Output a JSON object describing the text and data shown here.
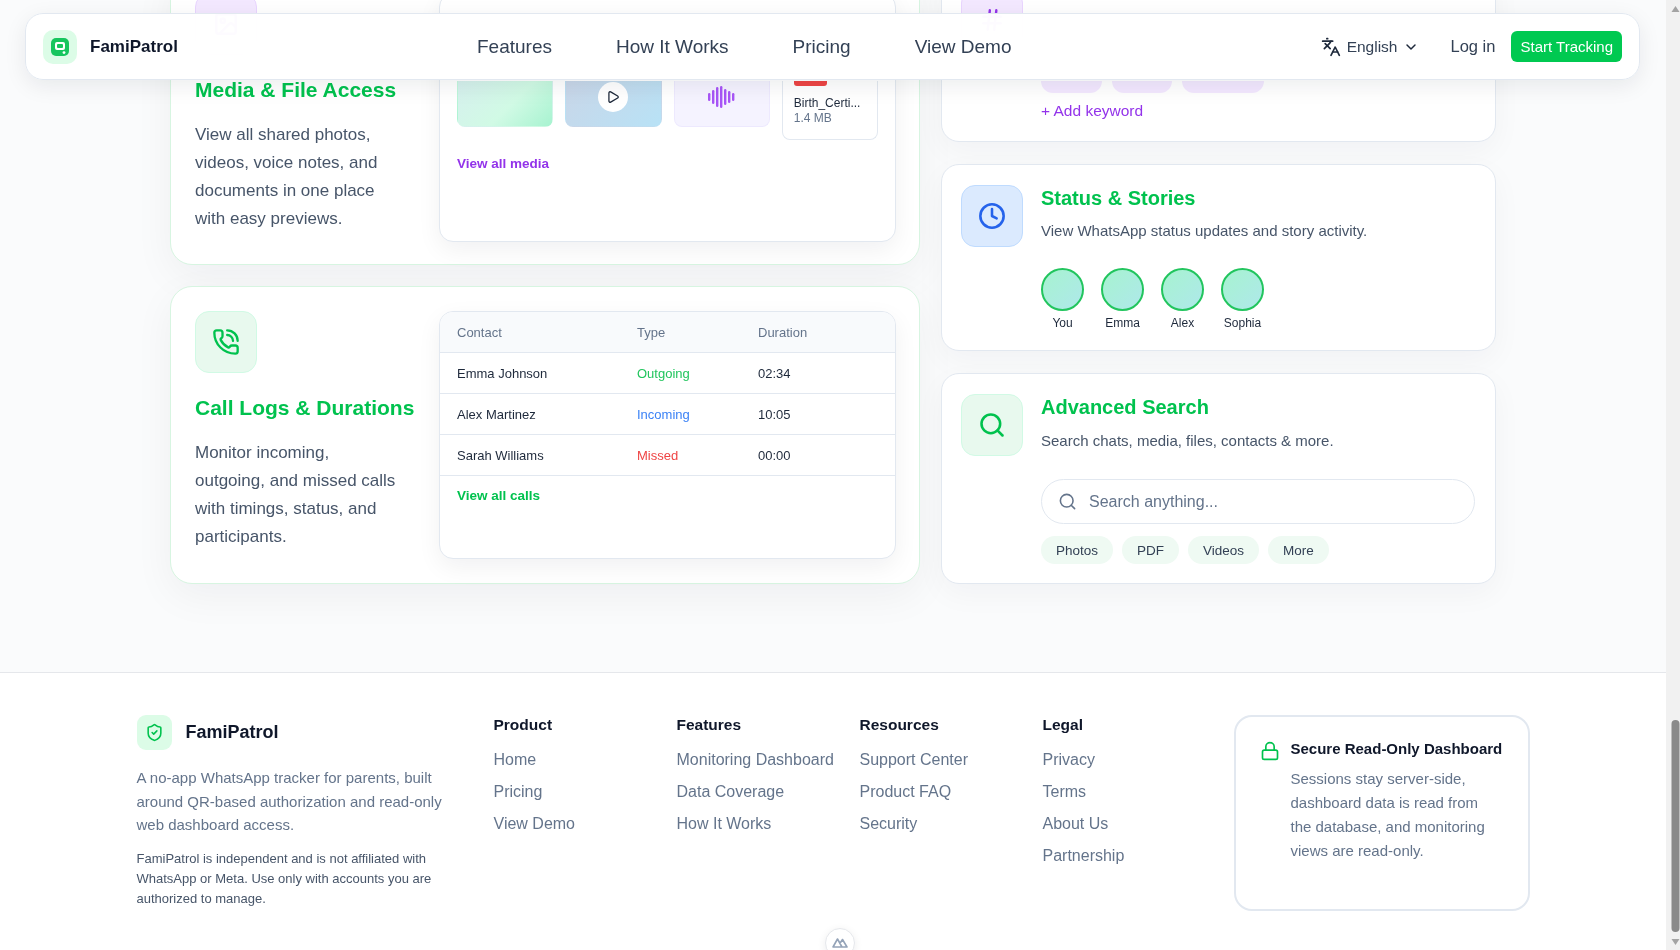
{
  "navbar": {
    "brand": "FamiPatrol",
    "links": [
      "Features",
      "How It Works",
      "Pricing",
      "View Demo"
    ],
    "language": "English",
    "login": "Log in",
    "cta": "Start Tracking"
  },
  "media_card": {
    "title": "Media & File Access",
    "description": "View all shared photos, videos, voice notes, and documents in one place with easy previews.",
    "items": [
      {
        "kind": "image"
      },
      {
        "kind": "video"
      },
      {
        "kind": "audio"
      },
      {
        "kind": "file",
        "name": "Birth_Certi...",
        "size": "1.4 MB"
      }
    ],
    "link": "View all media"
  },
  "keyword_card": {
    "add_link": "+ Add keyword"
  },
  "status_card": {
    "title": "Status & Stories",
    "description": "View WhatsApp status updates and story activity.",
    "stories": [
      {
        "name": "You"
      },
      {
        "name": "Emma"
      },
      {
        "name": "Alex"
      },
      {
        "name": "Sophia"
      }
    ]
  },
  "call_logs": {
    "title": "Call Logs & Durations",
    "description": "Monitor incoming, outgoing, and missed calls with timings, status, and participants.",
    "columns": [
      "Contact",
      "Type",
      "Duration"
    ],
    "rows": [
      {
        "contact": "Emma Johnson",
        "type": "Outgoing",
        "duration": "02:34",
        "color": "#22c55e"
      },
      {
        "contact": "Alex Martinez",
        "type": "Incoming",
        "duration": "10:05",
        "color": "#3b82f6"
      },
      {
        "contact": "Sarah Williams",
        "type": "Missed",
        "duration": "00:00",
        "color": "#ef4444"
      }
    ],
    "link": "View all calls"
  },
  "search_card": {
    "title": "Advanced Search",
    "description": "Search chats, media, files, contacts & more.",
    "search": {
      "placeholder": "Search anything..."
    },
    "filters": [
      "Photos",
      "PDF",
      "Videos",
      "More"
    ]
  },
  "footer": {
    "brand": "FamiPatrol",
    "description": "A no-app WhatsApp tracker for parents, built around QR-based authorization and read-only web dashboard access.",
    "disclaimer": "FamiPatrol is independent and is not affiliated with WhatsApp or Meta. Use only with accounts you are authorized to manage.",
    "columns": [
      {
        "heading": "Product",
        "links": [
          "Home",
          "Pricing",
          "View Demo"
        ]
      },
      {
        "heading": "Features",
        "links": [
          "Monitoring Dashboard",
          "Data Coverage",
          "How It Works"
        ]
      },
      {
        "heading": "Resources",
        "links": [
          "Support Center",
          "Product FAQ",
          "Security"
        ]
      },
      {
        "heading": "Legal",
        "links": [
          "Privacy",
          "Terms",
          "About Us",
          "Partnership"
        ]
      }
    ],
    "notice": {
      "title": "Secure Read-Only Dashboard",
      "text": "Sessions stay server-side, dashboard data is read from the database, and monitoring views are read-only."
    }
  }
}
